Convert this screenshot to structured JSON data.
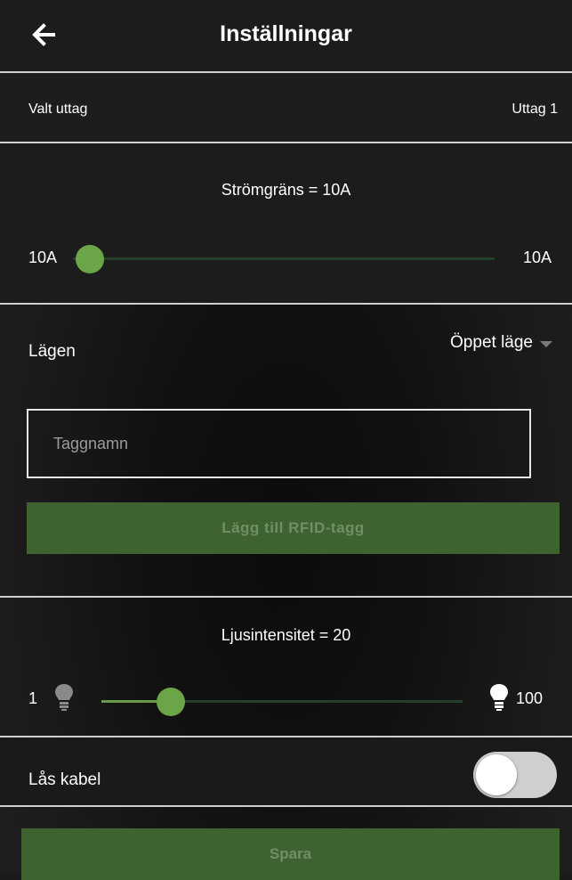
{
  "header": {
    "title": "Inställningar",
    "back_icon": "arrow-left-icon"
  },
  "outlet": {
    "label": "Valt uttag",
    "value": "Uttag 1"
  },
  "current_limit": {
    "title": "Strömgräns = 10A",
    "min_label": "10A",
    "max_label": "10A",
    "value_fraction": 0
  },
  "mode": {
    "label": "Lägen",
    "selected": "Öppet läge",
    "tag_placeholder": "Taggnamn",
    "add_button": "Lägg till RFID-tagg"
  },
  "light": {
    "title": "Ljusintensitet = 20",
    "min_label": "1",
    "max_label": "100",
    "value": 20,
    "min_icon": "lightbulb-dim-icon",
    "max_icon": "lightbulb-icon"
  },
  "lock": {
    "label": "Lås kabel",
    "enabled": false
  },
  "save_button": "Spara",
  "colors": {
    "accent": "#6aa647",
    "button_bg": "#3f6231",
    "button_text": "#6f8f66",
    "divider": "#cfcfcf"
  }
}
